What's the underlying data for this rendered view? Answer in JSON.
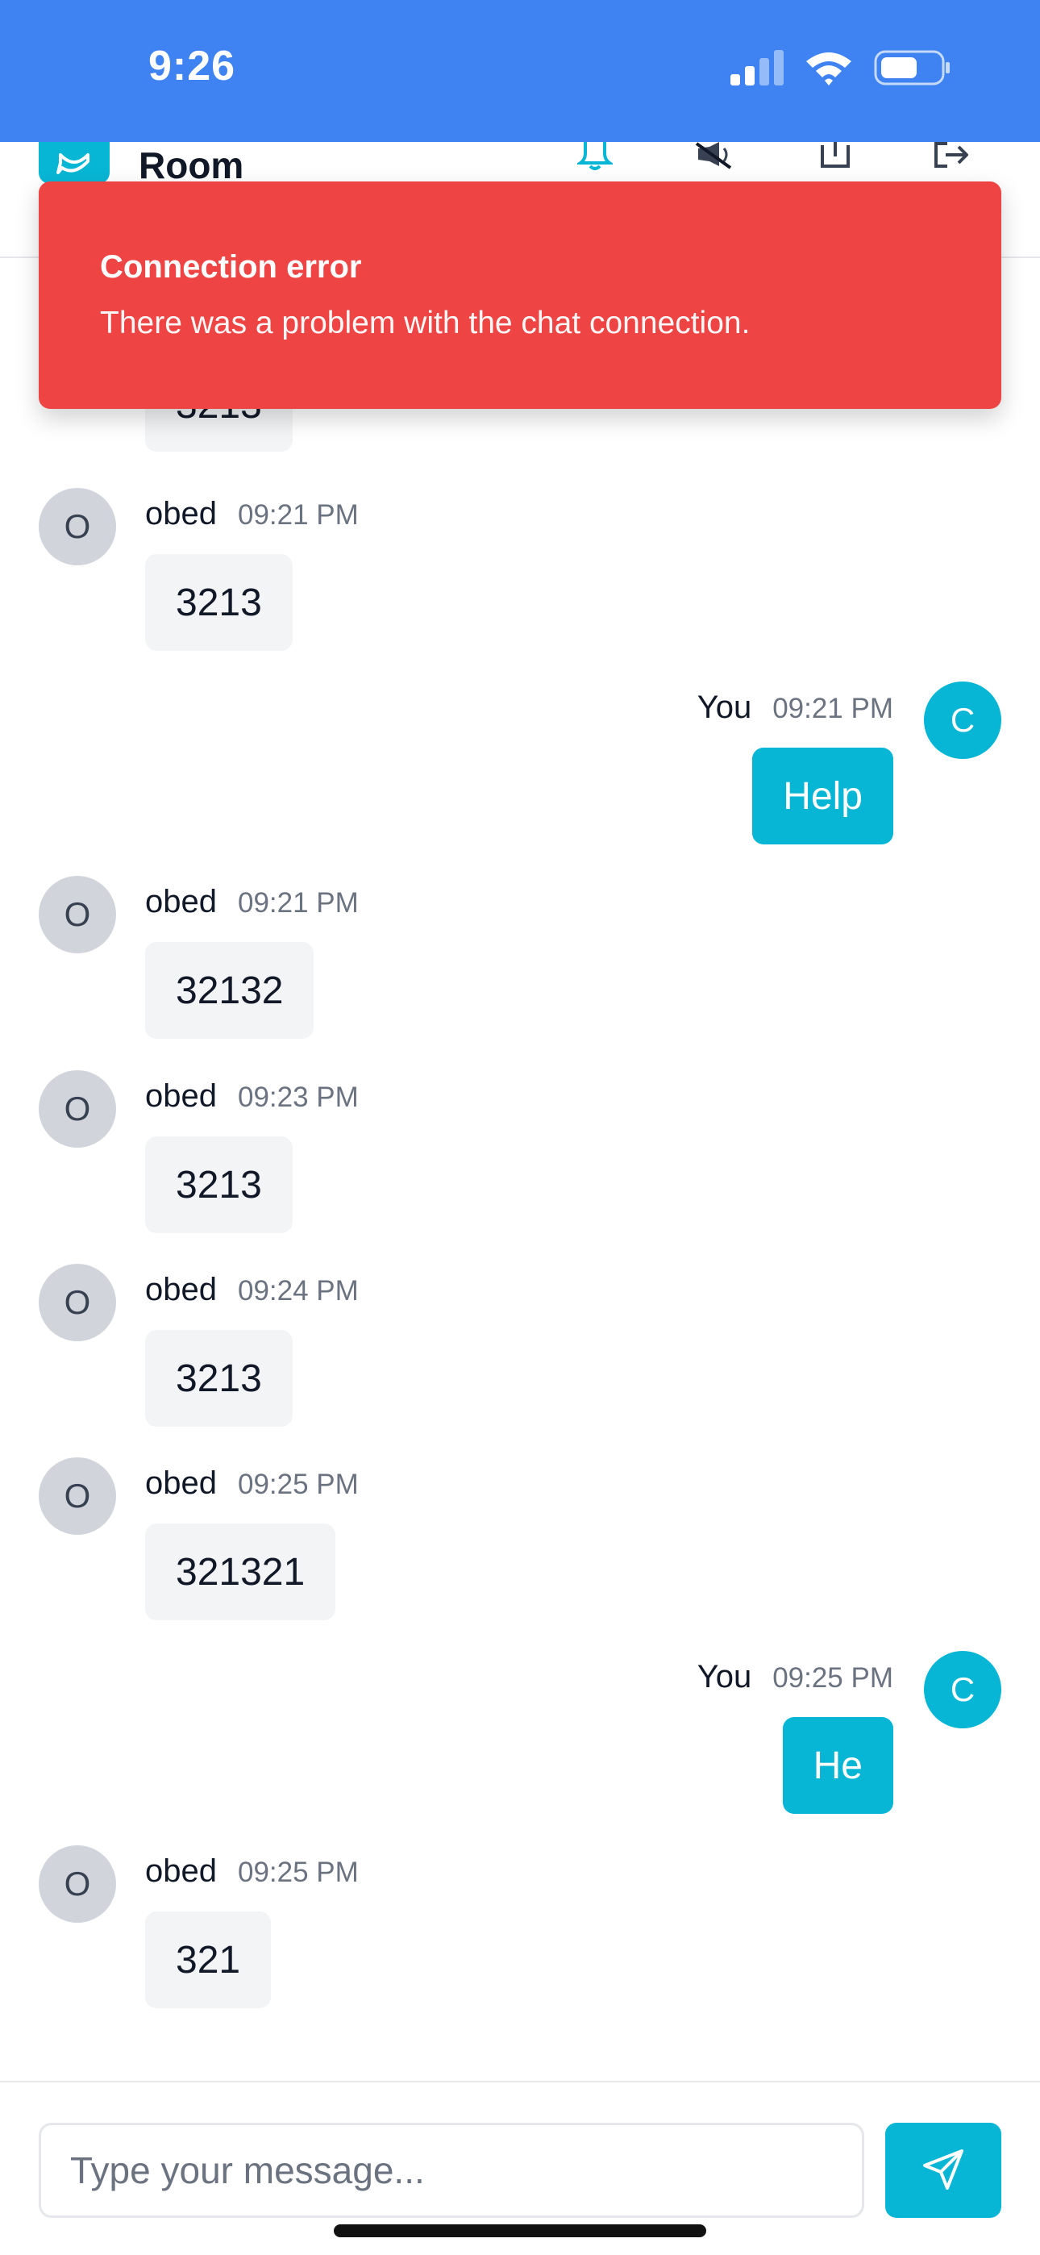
{
  "status_bar": {
    "time": "9:26",
    "icons": [
      "cellular-signal-icon",
      "wifi-icon",
      "battery-icon"
    ]
  },
  "header": {
    "title": "Room",
    "icons": [
      "chat-bubble-icon",
      "bell-icon",
      "mute-icon",
      "share-icon",
      "exit-icon"
    ]
  },
  "toast": {
    "title": "Connection error",
    "description": "There was a problem with the chat connection."
  },
  "messages": [
    {
      "sender": "",
      "time": "",
      "text": "3213",
      "is_self": false,
      "partial": true
    },
    {
      "sender": "obed",
      "initial": "O",
      "time": "09:21 PM",
      "text": "3213",
      "is_self": false
    },
    {
      "sender": "You",
      "initial": "C",
      "time": "09:21 PM",
      "text": "Help",
      "is_self": true
    },
    {
      "sender": "obed",
      "initial": "O",
      "time": "09:21 PM",
      "text": "32132",
      "is_self": false
    },
    {
      "sender": "obed",
      "initial": "O",
      "time": "09:23 PM",
      "text": "3213",
      "is_self": false
    },
    {
      "sender": "obed",
      "initial": "O",
      "time": "09:24 PM",
      "text": "3213",
      "is_self": false
    },
    {
      "sender": "obed",
      "initial": "O",
      "time": "09:25 PM",
      "text": "321321",
      "is_self": false
    },
    {
      "sender": "You",
      "initial": "C",
      "time": "09:25 PM",
      "text": "He",
      "is_self": true
    },
    {
      "sender": "obed",
      "initial": "O",
      "time": "09:25 PM",
      "text": "321",
      "is_self": false
    }
  ],
  "composer": {
    "placeholder": "Type your message...",
    "value": ""
  },
  "colors": {
    "status_bar": "#3f83f2",
    "accent": "#06b6d4",
    "error": "#ef4444",
    "bubble_other": "#f3f4f6",
    "avatar_other": "#d1d5db"
  }
}
